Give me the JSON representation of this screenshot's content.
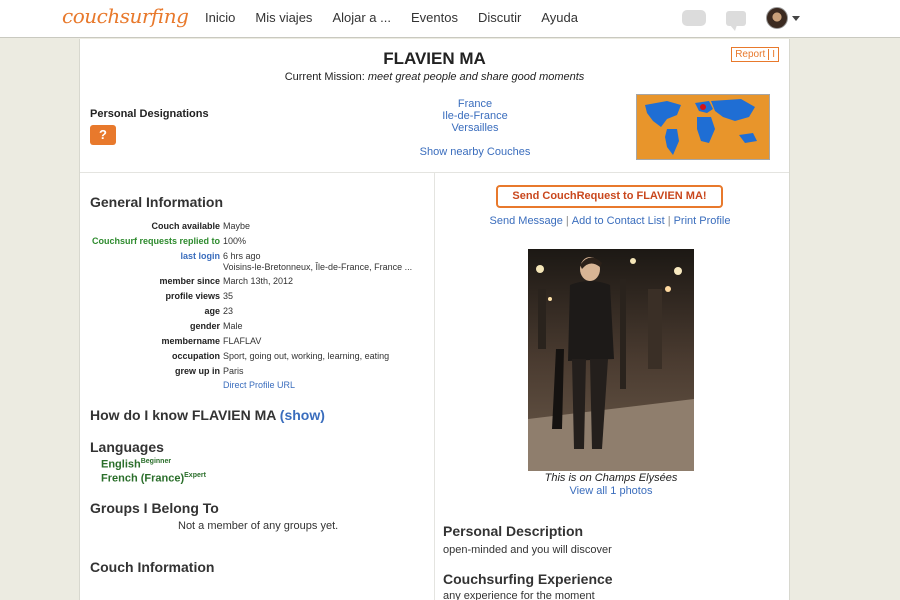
{
  "topbar": {
    "logo": "couchsurfing",
    "nav": [
      "Inicio",
      "Mis viajes",
      "Alojar a ...",
      "Eventos",
      "Discutir",
      "Ayuda"
    ]
  },
  "profile": {
    "name": "FLAVIEN MA",
    "mission_label": "Current Mission:",
    "mission_text": "meet great people and share good moments",
    "report": "Report",
    "report_extra": "I",
    "designations_title": "Personal Designations",
    "locations": [
      "France",
      "Ile-de-France",
      "Versailles"
    ],
    "nearby": "Show nearby Couches"
  },
  "general": {
    "title": "General Information",
    "rows": [
      {
        "label": "Couch available",
        "value": "Maybe"
      },
      {
        "label": "Couchsurf requests replied to",
        "value": "100%"
      },
      {
        "label": "last login",
        "value": "6 hrs ago"
      },
      {
        "label": "",
        "value": "Voisins-le-Bretonneux, Île-de-France, France ..."
      },
      {
        "label": "member since",
        "value": "March 13th, 2012"
      },
      {
        "label": "profile views",
        "value": "35"
      },
      {
        "label": "age",
        "value": "23"
      },
      {
        "label": "gender",
        "value": "Male"
      },
      {
        "label": "membername",
        "value": "FLAFLAV"
      },
      {
        "label": "occupation",
        "value": "Sport, going out, working, learning, eating"
      },
      {
        "label": "grew up in",
        "value": "Paris"
      }
    ],
    "direct_url": "Direct Profile URL"
  },
  "know": {
    "title": "How do I know FLAVIEN MA",
    "show": "(show)"
  },
  "languages": {
    "title": "Languages",
    "items": [
      {
        "name": "English",
        "level": "Beginner"
      },
      {
        "name": "French (France)",
        "level": "Expert"
      }
    ]
  },
  "groups": {
    "title": "Groups I Belong To",
    "text": "Not a member of any groups yet."
  },
  "couch_info": {
    "title": "Couch Information"
  },
  "right": {
    "send_button": "Send CouchRequest to FLAVIEN MA!",
    "send_message": "Send Message",
    "add_contact": "Add to Contact List",
    "print": "Print Profile",
    "caption": "This is on Champs Elysées",
    "view_all": "View all 1 photos",
    "desc_title": "Personal Description",
    "desc_text": "open-minded and you will discover",
    "exp_title": "Couchsurfing Experience",
    "exp_text": "any experience for the moment"
  },
  "colors": {
    "accent": "#e8792c",
    "link": "#3a6dbd",
    "green": "#2e8b2e"
  }
}
